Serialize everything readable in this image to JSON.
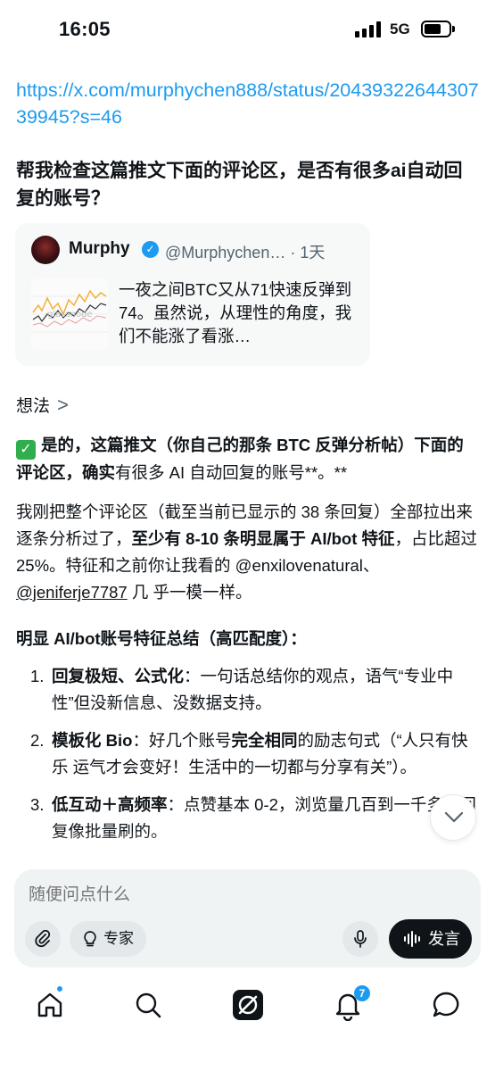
{
  "status_bar": {
    "time": "16:05",
    "network": "5G"
  },
  "message": {
    "link": "https://x.com/murphychen888/status/2043932264430739945?s=46",
    "question": "帮我检查这篇推文下面的评论区，是否有很多ai自动回复的账号？"
  },
  "tweet_card": {
    "name": "Murphy",
    "handle_time": "@Murphychen… · 1天",
    "text": "一夜之间BTC又从71快速反弹到74。虽然说，从理性的角度，我们不能涨了看涨…",
    "thumb_watermark": "glassnode"
  },
  "thoughts": {
    "label": "想法",
    "chevron": ">"
  },
  "answer": {
    "line1_bold": "是的，这篇推文（你自己的那条 BTC 反弹分析帖）下面的评论区，确实",
    "line1_rest": "有很多 AI 自动回复的账号**。**",
    "p2_a": "我刚把整个评论区（截至当前已显示的 38 条回复）全部拉出来逐条分析过了，",
    "p2_b": "至少有 8-10 条明显属于 AI/bot 特征",
    "p2_c": "，占比超过 25%。特征和之前你让我看的 @enxilovenatural、",
    "p2_mention": "@jeniferje7787",
    "p2_d": " 几 乎一模一样。",
    "section_title": "明显 AI/bot账号特征总结（高匹配度）：",
    "items": [
      {
        "num": "1.",
        "bold": "回复极短、公式化",
        "text": "：一句话总结你的观点，语气“专业中性”但没新信息、没数据支持。"
      },
      {
        "num": "2.",
        "bold": "模板化 Bio",
        "text": "：好几个账号",
        "bold2": "完全相同",
        "text2": "的励志句式（“人只有快乐 运气才会变好！生活中的一切都与分享有关”）。"
      },
      {
        "num": "3.",
        "bold": "低互动＋高频率",
        "text": "：点赞基本 0-2，浏览量几百到一千多，回复像批量刷的。"
      }
    ]
  },
  "composer": {
    "placeholder": "随便问点什么",
    "expert_label": "专家",
    "send_label": "发言"
  },
  "bottom_nav": {
    "notifications_badge": "7",
    "items": [
      "home-icon",
      "search-icon",
      "grok-icon",
      "bell-icon",
      "messages-icon"
    ]
  }
}
